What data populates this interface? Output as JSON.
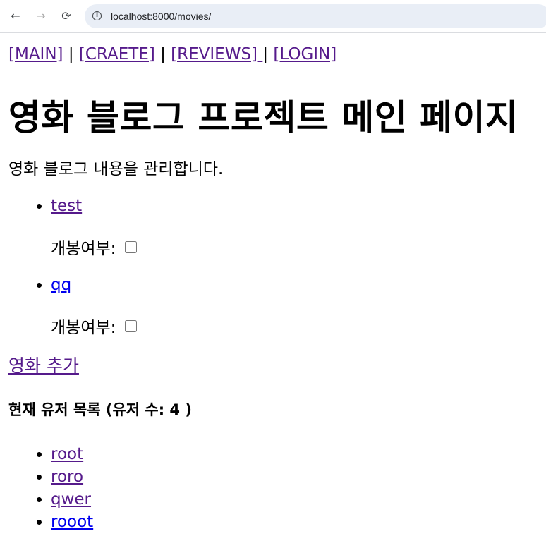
{
  "browser": {
    "url": "localhost:8000/movies/",
    "back_icon": "←",
    "forward_icon": "→",
    "reload_icon": "⟳"
  },
  "nav": {
    "main": "[MAIN]",
    "create": "[CRAETE]",
    "reviews": "[REVIEWS] ",
    "login": "[LOGIN]",
    "separator": "|"
  },
  "page": {
    "title": "영화 블로그 프로젝트 메인 페이지",
    "description": "영화 블로그 내용을 관리합니다.",
    "add_movie_link": "영화 추가"
  },
  "movies": [
    {
      "title": "test",
      "open_label": "개봉여부:",
      "open_checked": false,
      "visited": true
    },
    {
      "title": "qq",
      "open_label": "개봉여부:",
      "open_checked": false,
      "visited": false
    }
  ],
  "users": {
    "heading": "현재 유저 목록 (유저 수: 4 )",
    "list": [
      {
        "name": "root",
        "visited": true
      },
      {
        "name": "roro",
        "visited": true
      },
      {
        "name": "qwer",
        "visited": true
      },
      {
        "name": "rooot",
        "visited": false
      }
    ]
  }
}
